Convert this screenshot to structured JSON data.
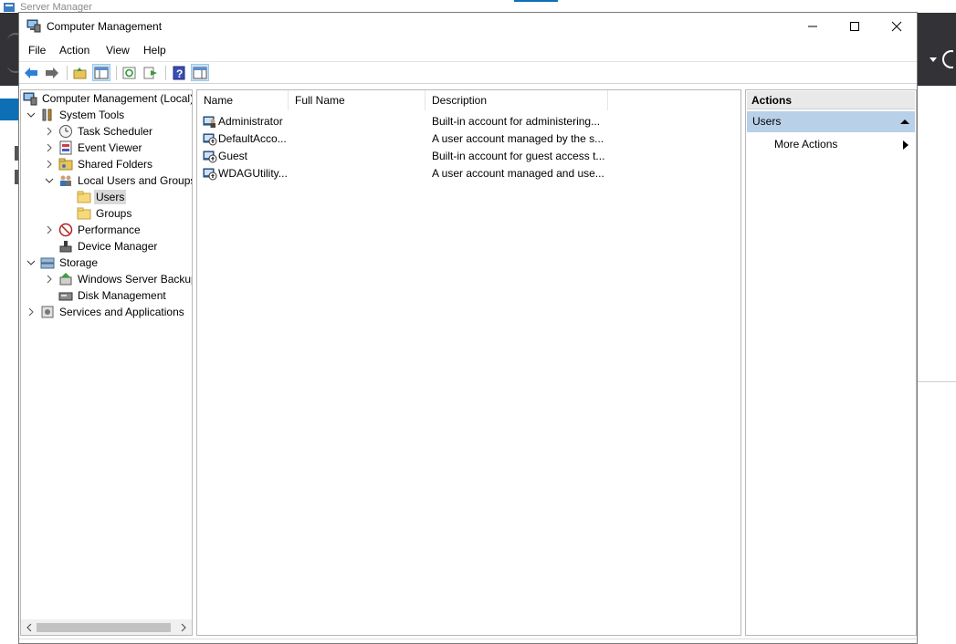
{
  "background": {
    "title": "Server Manager"
  },
  "window": {
    "title": "Computer Management"
  },
  "menu": [
    "File",
    "Action",
    "View",
    "Help"
  ],
  "toolbar": {
    "buttons": [
      "back-arrow-icon",
      "forward-arrow-icon",
      "up-folder-icon",
      "show-hide-tree-icon",
      "refresh-icon",
      "export-list-icon",
      "help-icon",
      "show-hide-action-pane-icon"
    ]
  },
  "tree": {
    "root": "Computer Management (Local)",
    "system_tools": "System Tools",
    "task_scheduler": "Task Scheduler",
    "event_viewer": "Event Viewer",
    "shared_folders": "Shared Folders",
    "local_users_groups": "Local Users and Groups",
    "users": "Users",
    "groups": "Groups",
    "performance": "Performance",
    "device_manager": "Device Manager",
    "storage": "Storage",
    "windows_server_backup": "Windows Server Backup",
    "disk_management": "Disk Management",
    "services_apps": "Services and Applications"
  },
  "list": {
    "columns": [
      "Name",
      "Full Name",
      "Description"
    ],
    "rows": [
      {
        "name": "Administrator",
        "full_name": "",
        "description": "Built-in account for administering..."
      },
      {
        "name": "DefaultAcco...",
        "full_name": "",
        "description": "A user account managed by the s..."
      },
      {
        "name": "Guest",
        "full_name": "",
        "description": "Built-in account for guest access t..."
      },
      {
        "name": "WDAGUtility...",
        "full_name": "",
        "description": "A user account managed and use..."
      }
    ]
  },
  "actions": {
    "header": "Actions",
    "section": "Users",
    "more": "More Actions"
  },
  "colors": {
    "accent": "#0d6fb6",
    "selection": "#d9d9d9",
    "action_section": "#b8d0e8"
  }
}
